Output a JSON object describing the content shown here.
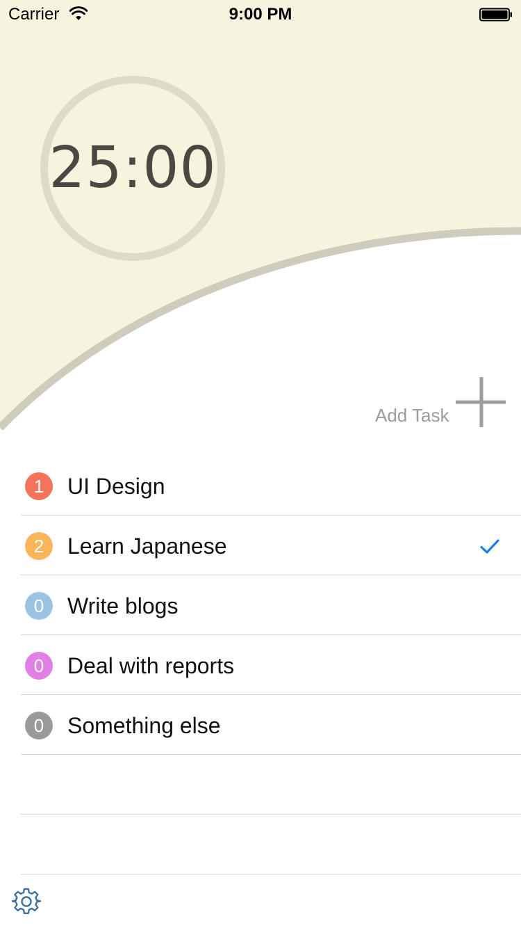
{
  "status_bar": {
    "carrier": "Carrier",
    "time": "9:00 PM",
    "icons": [
      "wifi-icon",
      "battery-icon"
    ]
  },
  "timer": {
    "value": "25:00"
  },
  "add_task": {
    "label": "Add Task",
    "icon": "plus-icon"
  },
  "tasks": [
    {
      "count": "1",
      "name": "UI Design",
      "color": "#f4735b",
      "checked": false
    },
    {
      "count": "2",
      "name": "Learn Japanese",
      "color": "#f8b559",
      "checked": true
    },
    {
      "count": "0",
      "name": "Write blogs",
      "color": "#9bc4e4",
      "checked": false
    },
    {
      "count": "0",
      "name": "Deal with reports",
      "color": "#e27fe6",
      "checked": false
    },
    {
      "count": "0",
      "name": "Something else",
      "color": "#9a9a9a",
      "checked": false
    }
  ],
  "settings": {
    "icon": "gear-icon"
  },
  "colors": {
    "header_bg": "#f6f4df",
    "arc": "#cfccbe",
    "timer_ring": "#dedcc8",
    "accent": "#1b7cf3",
    "muted_text": "#9b9b9b"
  }
}
